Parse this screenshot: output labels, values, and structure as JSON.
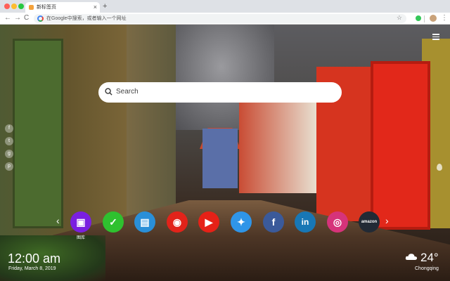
{
  "browser": {
    "tab_title": "新标签页",
    "tab_close": "×",
    "new_tab": "+",
    "omnibox_text": "在Google中搜索，或者输入一个网址",
    "nav": {
      "back": "←",
      "forward": "→",
      "reload": "C"
    },
    "star": "☆",
    "menu": "⋮"
  },
  "search": {
    "placeholder": "Search"
  },
  "social": [
    {
      "name": "facebook",
      "glyph": "f"
    },
    {
      "name": "twitter",
      "glyph": "t"
    },
    {
      "name": "google-plus",
      "glyph": "g"
    },
    {
      "name": "pinterest",
      "glyph": "p"
    }
  ],
  "quick_links": {
    "prev": "‹",
    "next": "›",
    "items": [
      {
        "name": "wallpaper",
        "label": "图库",
        "glyph": "▣",
        "color": "#7a1fe0"
      },
      {
        "name": "checklist",
        "label": "",
        "glyph": "✓",
        "color": "#2fc12f"
      },
      {
        "name": "news",
        "label": "",
        "glyph": "▤",
        "color": "#2a8fd8"
      },
      {
        "name": "games",
        "label": "",
        "glyph": "◉",
        "color": "#e2231a"
      },
      {
        "name": "youtube",
        "label": "",
        "glyph": "▶",
        "color": "#e62117"
      },
      {
        "name": "twitter",
        "label": "",
        "glyph": "✦",
        "color": "#2f95e8"
      },
      {
        "name": "facebook",
        "label": "",
        "glyph": "f",
        "color": "#3b5a9a"
      },
      {
        "name": "linkedin",
        "label": "",
        "glyph": "in",
        "color": "#1877b5"
      },
      {
        "name": "instagram",
        "label": "",
        "glyph": "◎",
        "color": "#d6337a"
      },
      {
        "name": "amazon",
        "label": "",
        "glyph": "amazon",
        "color": "#222a35"
      }
    ]
  },
  "clock": {
    "time": "12:00 am",
    "date": "Friday, March 8, 2019"
  },
  "weather": {
    "temperature": "24°",
    "city": "Chongqing",
    "icon": "cloud-icon"
  }
}
